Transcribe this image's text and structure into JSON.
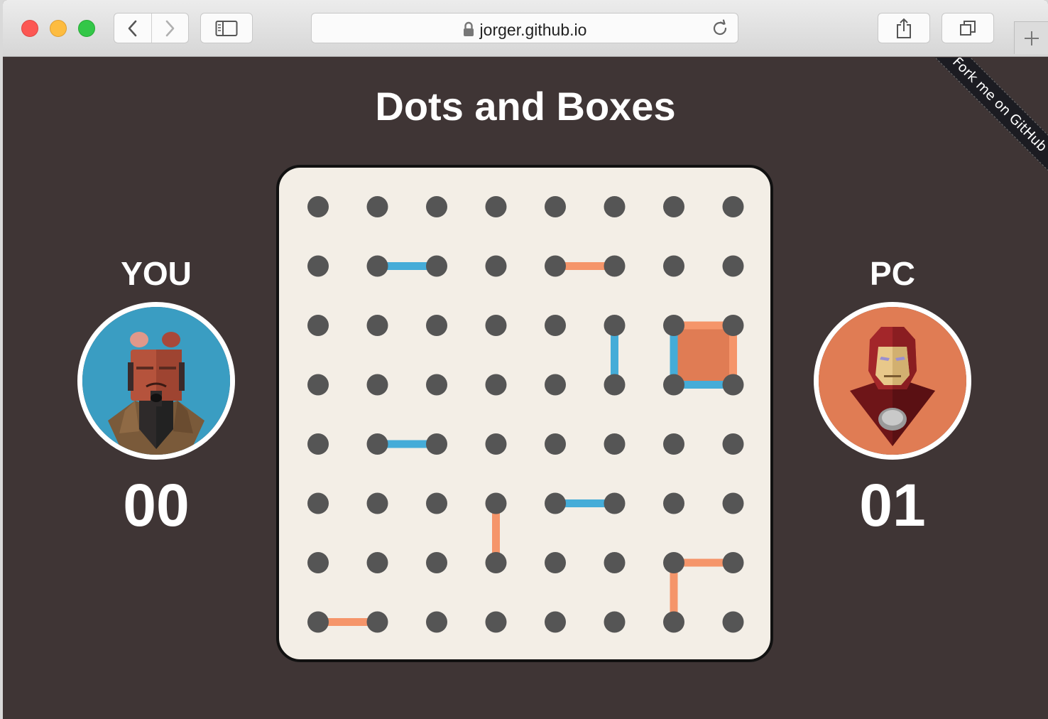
{
  "browser": {
    "url": "jorger.github.io",
    "icons": [
      "chevron-left-icon",
      "chevron-right-icon",
      "sidebar-icon",
      "lock-icon",
      "reload-icon",
      "share-icon",
      "tabs-icon",
      "plus-icon"
    ]
  },
  "page": {
    "title": "Dots and Boxes",
    "ribbon": "Fork me on GitHub"
  },
  "players": {
    "you": {
      "label": "YOU",
      "score": "00",
      "avatar_color": "#3a9dc2"
    },
    "pc": {
      "label": "PC",
      "score": "01",
      "avatar_color": "#e07c54"
    }
  },
  "board": {
    "size": 8,
    "dot_color": "#555555",
    "background": "#f3eee6",
    "player_colors": {
      "you": "#45acd8",
      "pc": "#f5956a"
    },
    "box_fill_pc": "#e07c54",
    "lines": [
      {
        "r1": 1,
        "c1": 1,
        "r2": 1,
        "c2": 2,
        "owner": "you"
      },
      {
        "r1": 1,
        "c1": 4,
        "r2": 1,
        "c2": 5,
        "owner": "pc"
      },
      {
        "r1": 2,
        "c1": 5,
        "r2": 3,
        "c2": 5,
        "owner": "you"
      },
      {
        "r1": 2,
        "c1": 6,
        "r2": 2,
        "c2": 7,
        "owner": "pc"
      },
      {
        "r1": 2,
        "c1": 6,
        "r2": 3,
        "c2": 6,
        "owner": "you"
      },
      {
        "r1": 2,
        "c1": 7,
        "r2": 3,
        "c2": 7,
        "owner": "pc"
      },
      {
        "r1": 3,
        "c1": 6,
        "r2": 3,
        "c2": 7,
        "owner": "you"
      },
      {
        "r1": 4,
        "c1": 1,
        "r2": 4,
        "c2": 2,
        "owner": "you"
      },
      {
        "r1": 5,
        "c1": 3,
        "r2": 6,
        "c2": 3,
        "owner": "pc"
      },
      {
        "r1": 5,
        "c1": 4,
        "r2": 5,
        "c2": 5,
        "owner": "you"
      },
      {
        "r1": 6,
        "c1": 6,
        "r2": 6,
        "c2": 7,
        "owner": "pc"
      },
      {
        "r1": 6,
        "c1": 6,
        "r2": 7,
        "c2": 6,
        "owner": "pc"
      },
      {
        "r1": 7,
        "c1": 0,
        "r2": 7,
        "c2": 1,
        "owner": "pc"
      }
    ],
    "boxes": [
      {
        "r": 2,
        "c": 6,
        "owner": "pc"
      }
    ]
  }
}
